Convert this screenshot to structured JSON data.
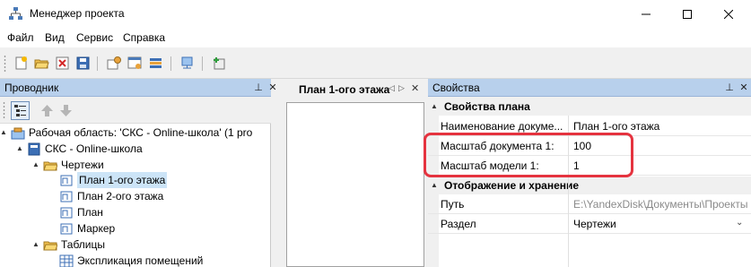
{
  "window": {
    "title": "Менеджер проекта"
  },
  "menu": [
    "Файл",
    "Вид",
    "Сервис",
    "Справка"
  ],
  "explorer": {
    "title": "Проводник",
    "tree": [
      {
        "label": "Рабочая область: 'СКС - Online-школа' (1 pro",
        "icon": "workspace-icon",
        "level": 0,
        "expander": "▲"
      },
      {
        "label": "СКС - Online-школа",
        "icon": "project-icon",
        "level": 1,
        "expander": "▲"
      },
      {
        "label": "Чертежи",
        "icon": "folder-icon",
        "level": 2,
        "expander": "▲"
      },
      {
        "label": "План 1-ого этажа",
        "icon": "plan-icon",
        "level": 3,
        "selected": true
      },
      {
        "label": "План 2-ого этажа",
        "icon": "plan-icon",
        "level": 3
      },
      {
        "label": "План",
        "icon": "plan-icon",
        "level": 3
      },
      {
        "label": "Маркер",
        "icon": "plan-icon",
        "level": 3
      },
      {
        "label": "Таблицы",
        "icon": "folder-icon",
        "level": 2,
        "expander": "▲"
      },
      {
        "label": "Экспликация помещений",
        "icon": "table-icon",
        "level": 3
      }
    ]
  },
  "document_tab": {
    "label": "План 1-ого этажа"
  },
  "properties": {
    "title": "Свойства",
    "categories": [
      {
        "name": "Свойства плана",
        "rows": [
          {
            "name": "Наименование документа",
            "display_name": "Наименование докуме...",
            "value": "План 1-ого этажа"
          },
          {
            "name": "Масштаб документа 1:",
            "value": "100"
          },
          {
            "name": "Масштаб модели 1:",
            "value": "1"
          }
        ]
      },
      {
        "name": "Отображение и хранение",
        "rows": [
          {
            "name": "Путь",
            "value": "E:\\YandexDisk\\Документы\\Проекты"
          },
          {
            "name": "Раздел",
            "value": "Чертежи"
          }
        ]
      }
    ]
  },
  "colors": {
    "panel_header": "#b8d0ec",
    "selection": "#cce4f7",
    "highlight": "#e5333f"
  }
}
